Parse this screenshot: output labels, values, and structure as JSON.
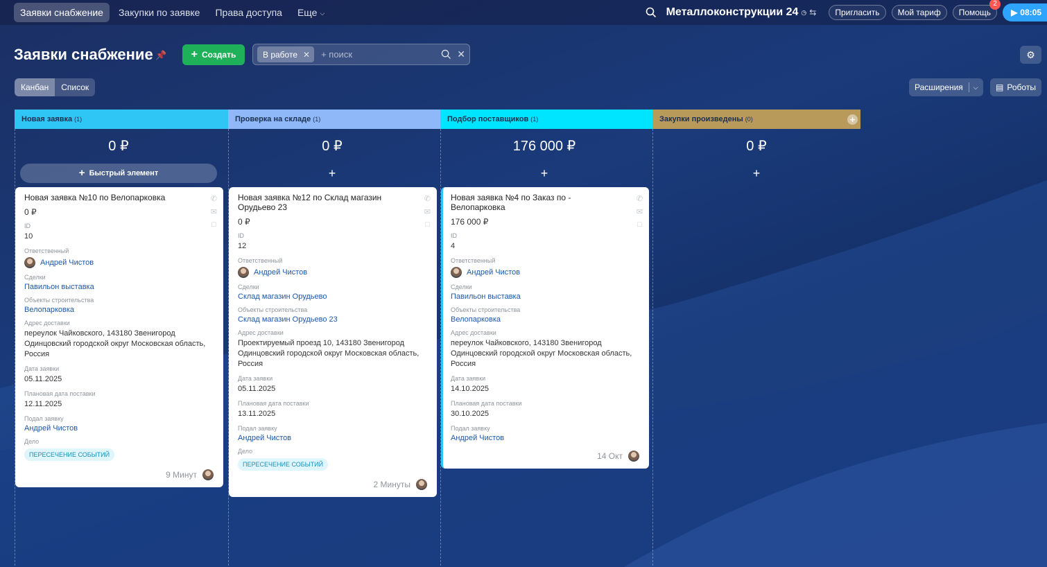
{
  "topnav": {
    "items": [
      "Заявки снабжение",
      "Закупки по заявке",
      "Права доступа",
      "Еще"
    ],
    "brand": "Металлоконструкции 24",
    "invite": "Пригласить",
    "tariff": "Мой тариф",
    "help": "Помощь",
    "help_badge": "2",
    "time": "08:05"
  },
  "header": {
    "title": "Заявки снабжение",
    "create_label": "Создать",
    "filter_chip": "В работе",
    "search_placeholder": "+ поиск"
  },
  "view": {
    "tabs": [
      "Канбан",
      "Список"
    ],
    "extensions_label": "Расширения",
    "robots_label": "Роботы",
    "quick_add_label": "Быстрый элемент"
  },
  "labels": {
    "id": "ID",
    "responsible": "Ответственный",
    "deals": "Сделки",
    "objects": "Объекты строительства",
    "address": "Адрес доставки",
    "date": "Дата заявки",
    "planned": "Плановая дата поставки",
    "submitted": "Подал заявку",
    "activity": "Дело"
  },
  "colors": {
    "col1": "#2fc6f6",
    "col2": "#8fb8f9",
    "col3": "#00e5ff",
    "col4": "#b89a5b",
    "create": "#1fb15a"
  },
  "columns": [
    {
      "name": "Новая заявка",
      "count": "(1)",
      "sum": "0 ₽"
    },
    {
      "name": "Проверка на складе",
      "count": "(1)",
      "sum": "0 ₽"
    },
    {
      "name": "Подбор поставщиков",
      "count": "(1)",
      "sum": "176 000 ₽"
    },
    {
      "name": "Закупки произведены",
      "count": "(0)",
      "sum": "0 ₽"
    }
  ],
  "cards": [
    {
      "title": "Новая заявка №10 по Велопарковка",
      "sum": "0 ₽",
      "id": "10",
      "responsible": "Андрей Чистов",
      "deal": "Павильон выставка",
      "object": "Велопарковка",
      "address": "переулок Чайковского, 143180 Звенигород Одинцовский городской округ Московская область, Россия",
      "date": "05.11.2025",
      "planned": "12.11.2025",
      "submitted": "Андрей Чистов",
      "activity": "ПЕРЕСЕЧЕНИЕ СОБЫТИЙ",
      "time": "9 Минут"
    },
    {
      "title": "Новая заявка №12 по Склад магазин Орудьево 23",
      "sum": "0 ₽",
      "id": "12",
      "responsible": "Андрей Чистов",
      "deal": "Склад магазин Орудьево",
      "object": "Склад магазин Орудьево 23",
      "address": "Проектируемый проезд 10, 143180 Звенигород Одинцовский городской округ Московская область, Россия",
      "date": "05.11.2025",
      "planned": "13.11.2025",
      "submitted": "Андрей Чистов",
      "activity": "ПЕРЕСЕЧЕНИЕ СОБЫТИЙ",
      "time": "2 Минуты"
    },
    {
      "title": "Новая заявка №4 по Заказ по - Велопарковка",
      "sum": "176 000 ₽",
      "id": "4",
      "responsible": "Андрей Чистов",
      "deal": "Павильон выставка",
      "object": "Велопарковка",
      "address": "переулок Чайковского, 143180 Звенигород Одинцовский городской округ Московская область, Россия",
      "date": "14.10.2025",
      "planned": "30.10.2025",
      "submitted": "Андрей Чистов",
      "time": "14 Окт"
    }
  ]
}
